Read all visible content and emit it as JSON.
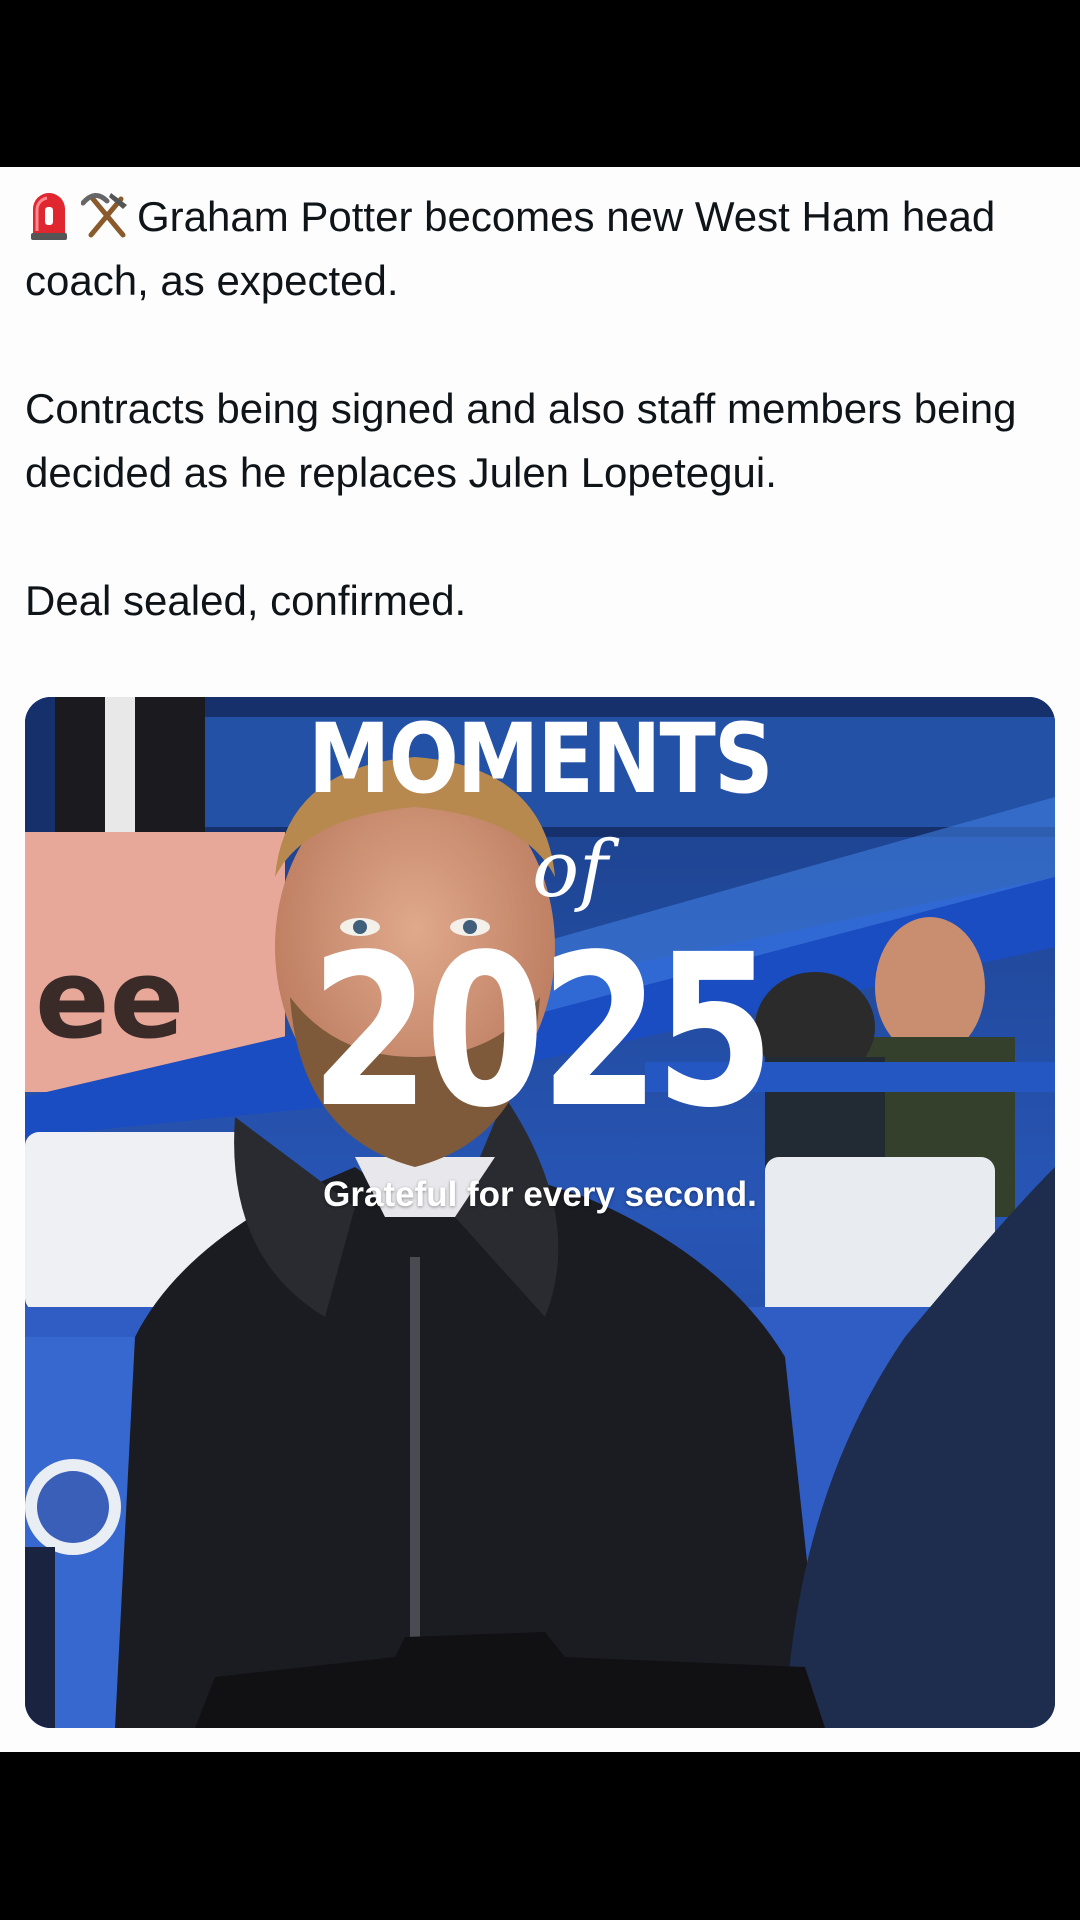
{
  "post": {
    "emojis": [
      "rotating-light-icon",
      "hammer-and-pick-icon"
    ],
    "line1": "Graham Potter becomes new West Ham head coach, as expected.",
    "line2": "Contracts being signed and also staff members being decided as he replaces Julen Lopetegui.",
    "line3": "Deal sealed, confirmed."
  },
  "media": {
    "title": "MOMENTS",
    "of": "of",
    "year": "2025",
    "caption": "Grateful for every second."
  }
}
